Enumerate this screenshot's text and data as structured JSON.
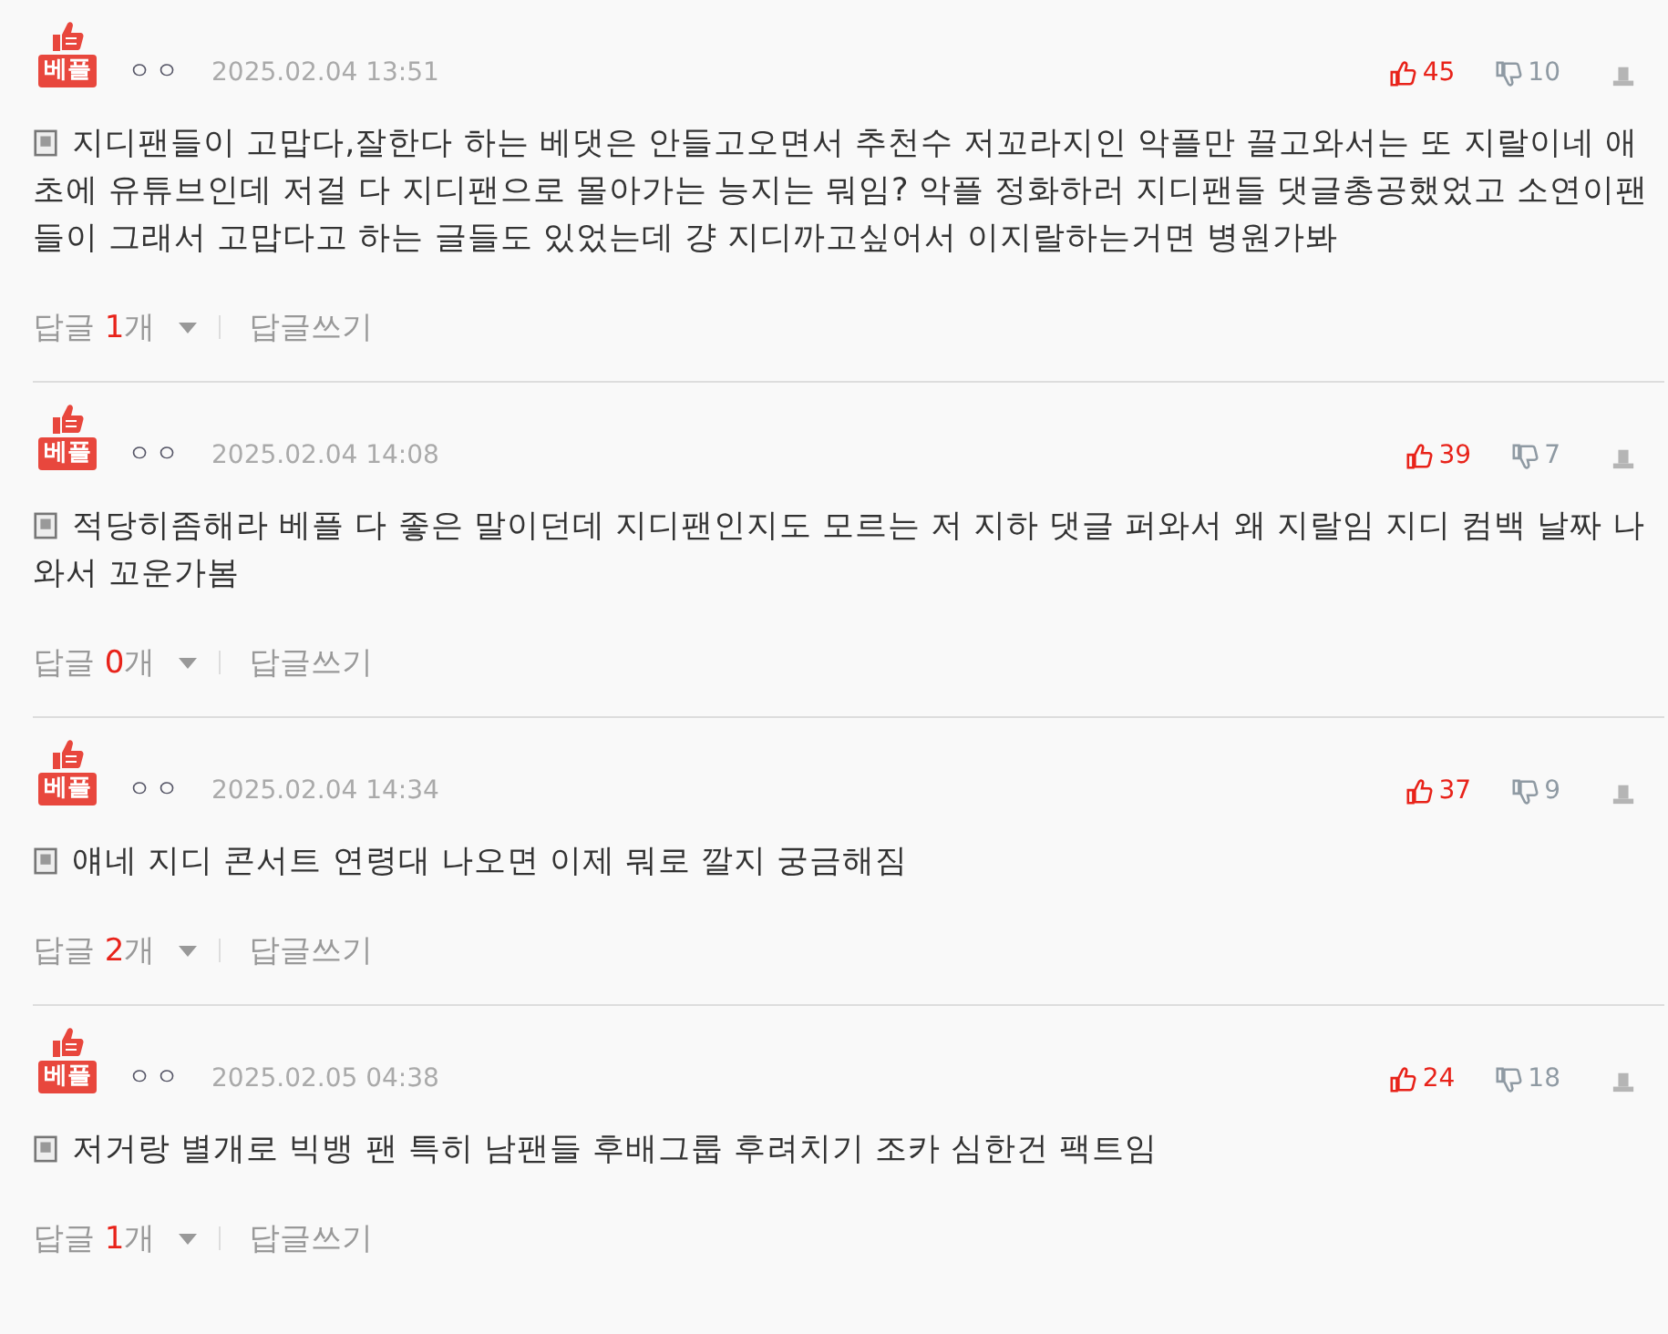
{
  "comments": [
    {
      "badge": "베플",
      "best": true,
      "user": "ㅇㅇ",
      "date": "2025.02.04 13:51",
      "likes": "45",
      "dislikes": "10",
      "text": "지디팬들이 고맙다,잘한다 하는 베댓은 안들고오면서 추천수 저꼬라지인 악플만 끌고와서는 또 지랄이네 애초에 유튜브인데 저걸 다 지디팬으로 몰아가는 능지는 뭐임? 악플 정화하러 지디팬들 댓글총공했었고 소연이팬들이 그래서 고맙다고 하는 글들도 있었는데 걍 지디까고싶어서 이지랄하는거면 병원가봐",
      "reply_label": "답글",
      "reply_count": "1",
      "reply_unit": "개",
      "write_label": "답글쓰기"
    },
    {
      "badge": "베플",
      "best": true,
      "user": "ㅇㅇ",
      "date": "2025.02.04 14:08",
      "likes": "39",
      "dislikes": "7",
      "text": "적당히좀해라 베플 다 좋은 말이던데 지디팬인지도 모르는 저 지하 댓글 퍼와서 왜 지랄임 지디 컴백 날짜 나와서 꼬운가봄",
      "reply_label": "답글",
      "reply_count": "0",
      "reply_unit": "개",
      "write_label": "답글쓰기"
    },
    {
      "badge": "베플",
      "best": true,
      "user": "ㅇㅇ",
      "date": "2025.02.04 14:34",
      "likes": "37",
      "dislikes": "9",
      "text": "얘네 지디 콘서트 연령대 나오면 이제 뭐로 깔지 궁금해짐",
      "reply_label": "답글",
      "reply_count": "2",
      "reply_unit": "개",
      "write_label": "답글쓰기"
    },
    {
      "badge": "베플",
      "best": true,
      "user": "ㅇㅇ",
      "date": "2025.02.05 04:38",
      "likes": "24",
      "dislikes": "18",
      "text": "저거랑 별개로 빅뱅 팬 특히 남팬들 후배그룹 후려치기 조카 심한건 팩트임",
      "reply_label": "답글",
      "reply_count": "1",
      "reply_unit": "개",
      "write_label": "답글쓰기"
    }
  ]
}
